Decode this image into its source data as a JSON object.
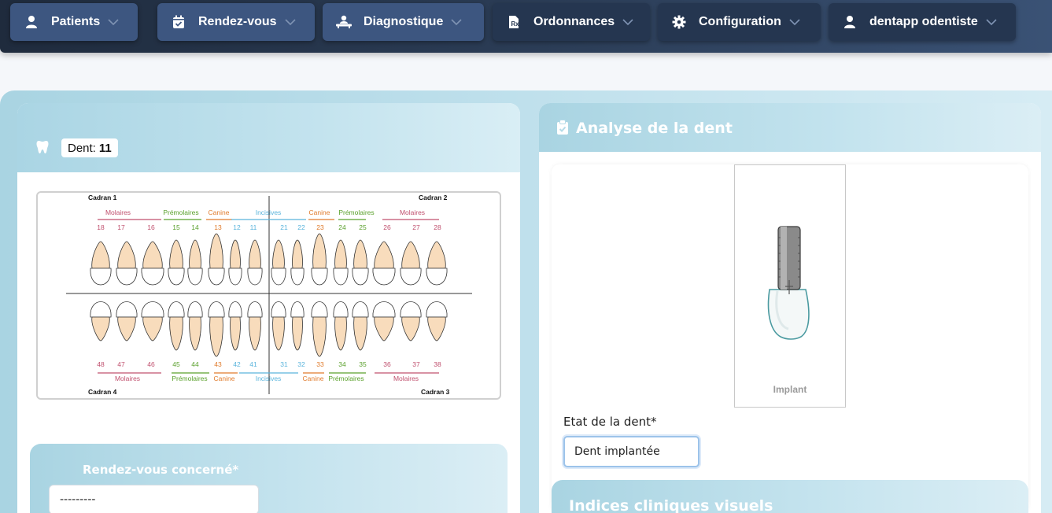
{
  "nav": {
    "items": [
      {
        "label": "Patients",
        "icon": "user-icon"
      },
      {
        "label": "Rendez-vous",
        "icon": "calendar-check-icon"
      },
      {
        "label": "Diagnostique",
        "icon": "patient-bed-icon"
      },
      {
        "label": "Ordonnances",
        "icon": "prescription-icon"
      },
      {
        "label": "Configuration",
        "icon": "gear-icon"
      },
      {
        "label": "dentapp odentiste",
        "icon": "user-icon"
      }
    ]
  },
  "left": {
    "dent_label": "Dent:",
    "dent_number": "11",
    "chart": {
      "quadrants": {
        "q1": "Cadran 1",
        "q2": "Cadran 2",
        "q3": "Cadran 3",
        "q4": "Cadran 4"
      },
      "upper_groups": [
        "Molaires",
        "Prémolaires",
        "Canine",
        "Incisives",
        "Canine",
        "Prémolaires",
        "Molaires"
      ],
      "lower_groups": [
        "Molaires",
        "Prémolaires",
        "Canine",
        "Incisives",
        "Canine",
        "Prémolaires",
        "Molaires"
      ],
      "upper_numbers": [
        "18",
        "17",
        "16",
        "15",
        "14",
        "13",
        "12",
        "11",
        "21",
        "22",
        "23",
        "24",
        "25",
        "26",
        "27",
        "28"
      ],
      "lower_numbers": [
        "48",
        "47",
        "46",
        "45",
        "44",
        "43",
        "42",
        "41",
        "31",
        "32",
        "33",
        "34",
        "35",
        "36",
        "37",
        "38"
      ],
      "colors": {
        "molar": "#c0506e",
        "premolar": "#5aa02c",
        "canine": "#e07b2c",
        "incisor": "#5ab4dc"
      }
    },
    "rdv_label": "Rendez-vous concerné*",
    "rdv_value": "---------"
  },
  "right": {
    "title": "Analyse de la dent",
    "image_caption": "Implant",
    "etat_label": "Etat de la dent*",
    "etat_value": "Dent implantée",
    "indices_title": "Indices cliniques visuels"
  }
}
